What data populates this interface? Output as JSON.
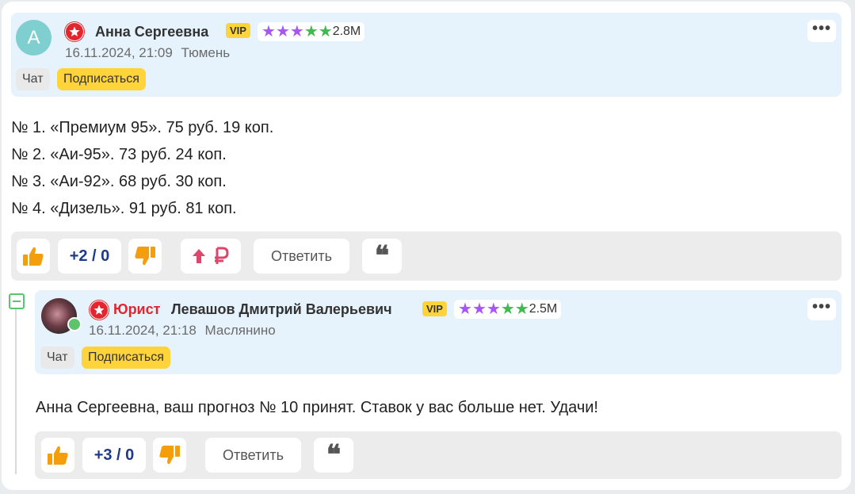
{
  "comment1": {
    "avatar_letter": "A",
    "author": "Анна Сергеевна",
    "vip": "VIP",
    "rating_count": "2.8M",
    "date": "16.11.2024, 21:09",
    "city": "Тюмень",
    "chat_label": "Чат",
    "subscribe_label": "Подписаться",
    "more_label": "•••",
    "lines": [
      "№ 1. «Премиум 95». 75 руб. 19 коп.",
      "№ 2. «Аи-95». 73 руб. 24 коп.",
      "№ 3. «Аи-92». 68 руб. 30 коп.",
      "№ 4. «Дизель». 91 руб. 81 коп."
    ],
    "votes": "+2 / 0",
    "reply_label": "Ответить",
    "quote_label": "❝"
  },
  "comment2": {
    "role": "Юрист",
    "author": "Левашов Дмитрий Валерьевич",
    "vip": "VIP",
    "rating_count": "2.5M",
    "date": "16.11.2024, 21:18",
    "city": "Маслянино",
    "chat_label": "Чат",
    "subscribe_label": "Подписаться",
    "more_label": "•••",
    "text": "Анна Сергеевна, ваш прогноз № 10 принят. Ставок у вас больше нет. Удачи!",
    "votes": "+3 / 0",
    "reply_label": "Ответить",
    "quote_label": "❝"
  },
  "colors": {
    "header_bg": "#e6f2fc",
    "vip_yellow": "#ffd33a",
    "badge_red": "#e4252e",
    "star_purple": "#a855f7",
    "star_green": "#3fb950",
    "thumb_orange": "#f59e0b",
    "vote_blue": "#1e3a8a",
    "donate_pink": "#e0456b"
  },
  "icons": [
    "badge-icon",
    "star-icon",
    "thumbs-up-icon",
    "thumbs-down-icon",
    "upvote-arrow-icon",
    "ruble-icon",
    "quote-icon",
    "more-icon",
    "collapse-icon"
  ]
}
